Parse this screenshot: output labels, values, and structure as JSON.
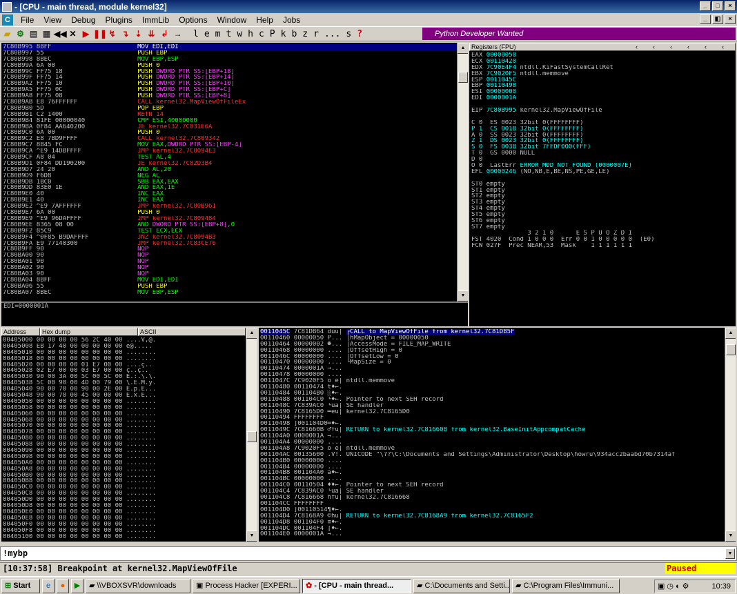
{
  "title": "- [CPU - main thread, module kernel32]",
  "menu": [
    "File",
    "View",
    "Debug",
    "Plugins",
    "ImmLib",
    "Options",
    "Window",
    "Help",
    "Jobs"
  ],
  "toolbar_letters": [
    "l",
    "e",
    "m",
    "t",
    "w",
    "h",
    "c",
    "P",
    "k",
    "b",
    "z",
    "r",
    "...",
    "s",
    "?"
  ],
  "banner": "Python Developer Wanted",
  "disasm": [
    [
      "7C80B995",
      "8BFF",
      "MOV EDI,EDI",
      "sel"
    ],
    [
      "7C80B997",
      "55",
      "PUSH EBP",
      "y"
    ],
    [
      "7C80B998",
      "8BEC",
      "MOV EBP,ESP",
      "g"
    ],
    [
      "7C80B99A",
      "6A 00",
      "PUSH 0",
      "y"
    ],
    [
      "7C80B99C",
      "FF75 18",
      "PUSH DWORD PTR SS:[EBP+18]",
      "ym"
    ],
    [
      "7C80B99F",
      "FF75 14",
      "PUSH DWORD PTR SS:[EBP+14]",
      "ym"
    ],
    [
      "7C80B9A2",
      "FF75 10",
      "PUSH DWORD PTR SS:[EBP+10]",
      "ym"
    ],
    [
      "7C80B9A5",
      "FF75 0C",
      "PUSH DWORD PTR SS:[EBP+C]",
      "ym"
    ],
    [
      "7C80B9A8",
      "FF75 08",
      "PUSH DWORD PTR SS:[EBP+8]",
      "ym"
    ],
    [
      "7C80B9AB",
      "E8 76FFFFFF",
      "CALL kernel32.MapViewOfFileEx",
      "r"
    ],
    [
      "7C80B9B0",
      "5D",
      "POP EBP",
      "y"
    ],
    [
      "7C80B9B1",
      "C2 1400",
      "RETN 14",
      "r"
    ],
    [
      "7C80B9B4",
      "81FE 00000040",
      "CMP ESI,40000000",
      "g"
    ],
    [
      "7C80B9BA",
      "0F84 AA640200",
      "JE kernel32.7C831E6A",
      "r"
    ],
    [
      "7C80B9C0",
      "6A 00",
      "PUSH 0",
      "y"
    ],
    [
      "7C80B9C2",
      "E8 7BD9FFFF",
      "CALL kernel32.7C809342",
      "r"
    ],
    [
      "7C80B9C7",
      "8B45 FC",
      "MOV EAX,DWORD PTR SS:[EBP-4]",
      "gm"
    ],
    [
      "7C80B9CA ^E9",
      "14DBFFFF",
      "JMP kernel32.7C8094E3",
      "r"
    ],
    [
      "7C80B9CF",
      "A8 04",
      "TEST AL,4",
      "g"
    ],
    [
      "7C80B9D1",
      "0F84 DD190200",
      "JE kernel32.7C82D3B4",
      "r"
    ],
    [
      "7C80B9D7",
      "24 20",
      "AND AL,20",
      "g"
    ],
    [
      "7C80B9D9",
      "F6D8",
      "NEG AL",
      "g"
    ],
    [
      "7C80B9DB",
      "1BC0",
      "SBB EAX,EAX",
      "g"
    ],
    [
      "7C80B9DD",
      "83E0 1E",
      "AND EAX,1E",
      "g"
    ],
    [
      "7C80B9E0",
      "40",
      "INC EAX",
      "g"
    ],
    [
      "7C80B9E1",
      "40",
      "INC EAX",
      "g"
    ],
    [
      "7C80B9E2 ^E9",
      "7AFFFFFF",
      "JMP kernel32.7C80B961",
      "r"
    ],
    [
      "7C80B9E7",
      "6A 00",
      "PUSH 0",
      "y"
    ],
    [
      "7C80B9E9 ^E9",
      "96DAFFFF",
      "JMP kernel32.7C809484",
      "r"
    ],
    [
      "7C80B9EE",
      "8365 08 00",
      "AND DWORD PTR SS:[EBP+8],0",
      "gm"
    ],
    [
      "7C80B9F2",
      "85C9",
      "TEST ECX,ECX",
      "g"
    ],
    [
      "7C80B9F4 ^0F85",
      "B9DAFFFF",
      "JNZ kernel32.7C8094B3",
      "r"
    ],
    [
      "7C80B9FA",
      "E9 77140300",
      "JMP kernel32.7C83CE76",
      "r"
    ],
    [
      "7C80B9FF",
      "90",
      "NOP",
      "m"
    ],
    [
      "7C80BA00",
      "90",
      "NOP",
      "m"
    ],
    [
      "7C80BA01",
      "90",
      "NOP",
      "m"
    ],
    [
      "7C80BA02",
      "90",
      "NOP",
      "m"
    ],
    [
      "7C80BA03",
      "90",
      "NOP",
      "m"
    ],
    [
      "7C80BA04",
      "8BFF",
      "MOV EDI,EDI",
      "g"
    ],
    [
      "7C80BA06",
      "55",
      "PUSH EBP",
      "y"
    ],
    [
      "7C80BA07",
      "8BEC",
      "MOV EBP,ESP",
      "g"
    ]
  ],
  "info_line": "EDI=0000001A",
  "registers_title": "Registers (FPU)",
  "registers": [
    [
      "EAX",
      "00000050",
      ""
    ],
    [
      "ECX",
      "00110420",
      ""
    ],
    [
      "EDX",
      "7C90E4F4",
      "ntdll.KiFastSystemCallRet"
    ],
    [
      "EBX",
      "7C9020F5",
      "ntdll.memmove"
    ],
    [
      "ESP",
      "0011045C",
      ""
    ],
    [
      "EBP",
      "00110498",
      ""
    ],
    [
      "ESI",
      "00000000",
      ""
    ],
    [
      "EDI",
      "0000001A",
      ""
    ]
  ],
  "eip": [
    "EIP",
    "7C80B995",
    "kernel32.MapViewOfFile"
  ],
  "flags": [
    "C 0  ES 0023 32bit 0(FFFFFFFF)",
    "P 1  CS 001B 32bit 0(FFFFFFFF)",
    "A 0  SS 0023 32bit 0(FFFFFFFF)",
    "Z 1  DS 0023 32bit 0(FFFFFFFF)",
    "S 0  FS 003B 32bit 7FFDF000(FFF)",
    "T 0  GS 0000 NULL",
    "D 0",
    "O 0  LastErr ERROR_MOD_NOT_FOUND (0000007E)"
  ],
  "efl": "EFL 00000246 (NO,NB,E,BE,NS,PE,GE,LE)",
  "st": [
    "ST0 empty",
    "ST1 empty",
    "ST2 empty",
    "ST3 empty",
    "ST4 empty",
    "ST5 empty",
    "ST6 empty",
    "ST7 empty"
  ],
  "fpu_bits": "               3 2 1 0      E S P U O Z D I",
  "fst": "FST 4020  Cond 1 0 0 0  Err 0 0 1 0 0 0 0 0  (E0)",
  "fcw": "FCW 027F  Prec NEAR,53  Mask    1 1 1 1 1 1",
  "dump_headers": [
    "Address",
    "Hex dump",
    "ASCII"
  ],
  "dump": [
    [
      "00405000",
      "00 00 00 00 56 2C 40 00",
      "....V,@."
    ],
    [
      "00405008",
      "EB 17 40 00 00 00 00 00",
      "ë\u0017@....."
    ],
    [
      "00405010",
      "00 00 00 00 00 00 00 00",
      "........"
    ],
    [
      "00405018",
      "00 00 00 00 00 00 00 00",
      "........"
    ],
    [
      "00405020",
      "00 00 00 00 01 E7 00 00",
      "....ç.."
    ],
    [
      "00405028",
      "02 E7 00 00 03 E7 00 00",
      "ç..ç.."
    ],
    [
      "00405030",
      "90 00 3A 00 5C 00 5C 00",
      "E.:.\\.\\."
    ],
    [
      "00405038",
      "5C 00 90 00 4D 00 79 00",
      "\\.E.M.y."
    ],
    [
      "00405040",
      "90 00 70 00 90 00 2E 00",
      "E.p.E..."
    ],
    [
      "00405048",
      "90 00 78 00 45 00 00 00",
      "E.x.E..."
    ],
    [
      "00405050",
      "00 00 00 00 00 00 00 00",
      "........"
    ],
    [
      "00405058",
      "00 00 00 00 00 00 00 00",
      "........"
    ],
    [
      "00405060",
      "00 00 00 00 00 00 00 00",
      "........"
    ],
    [
      "00405068",
      "00 00 00 00 00 00 00 00",
      "........"
    ],
    [
      "00405070",
      "00 00 00 00 00 00 00 00",
      "........"
    ],
    [
      "00405078",
      "00 00 00 00 00 00 00 00",
      "........"
    ],
    [
      "00405080",
      "00 00 00 00 00 00 00 00",
      "........"
    ],
    [
      "00405088",
      "00 00 00 00 00 00 00 00",
      "........"
    ],
    [
      "00405090",
      "00 00 00 00 00 00 00 00",
      "........"
    ],
    [
      "00405098",
      "00 00 00 00 00 00 00 00",
      "........"
    ],
    [
      "004050A0",
      "00 00 00 00 00 00 00 00",
      "........"
    ],
    [
      "004050A8",
      "00 00 00 00 00 00 00 00",
      "........"
    ],
    [
      "004050B0",
      "00 00 00 00 00 00 00 00",
      "........"
    ],
    [
      "004050B8",
      "00 00 00 00 00 00 00 00",
      "........"
    ],
    [
      "004050C0",
      "00 00 00 00 00 00 00 00",
      "........"
    ],
    [
      "004050C8",
      "00 00 00 00 00 00 00 00",
      "........"
    ],
    [
      "004050D0",
      "00 00 00 00 00 00 00 00",
      "........"
    ],
    [
      "004050D8",
      "00 00 00 00 00 00 00 00",
      "........"
    ],
    [
      "004050E0",
      "00 00 00 00 00 00 00 00",
      "........"
    ],
    [
      "004050E8",
      "00 00 00 00 00 00 00 00",
      "........"
    ],
    [
      "004050F0",
      "00 00 00 00 00 00 00 00",
      "........"
    ],
    [
      "004050F8",
      "00 00 00 00 00 00 00 00",
      "........"
    ],
    [
      "00405100",
      "00 00 00 00 00 00 00 00",
      "........"
    ]
  ],
  "stack": [
    [
      "0011045C",
      "7C81DB64",
      "dûü|",
      "┌CALL to MapViewOfFile from kernel32.7C81DB5F",
      "sel"
    ],
    [
      "00110460",
      "00000050",
      "P...",
      "│hMapObject = 00000050",
      ""
    ],
    [
      "00110464",
      "00000002",
      "☻...",
      "│AccessMode = FILE_MAP_WRITE",
      ""
    ],
    [
      "00110468",
      "00000000",
      "....",
      "│OffsetHigh = 0",
      ""
    ],
    [
      "0011046C",
      "00000000",
      "....",
      "│OffsetLow = 0",
      ""
    ],
    [
      "00110470",
      "00000000",
      "....",
      "└MapSize = 0",
      ""
    ],
    [
      "00110474",
      "0000001A",
      "→...",
      "",
      ""
    ],
    [
      "00110478",
      "00000000",
      "....",
      "",
      ""
    ],
    [
      "0011047C",
      "7C9020F5",
      "õ é|",
      "ntdll.memmove",
      ""
    ],
    [
      "00110480",
      "00110474",
      "t♦←.",
      "",
      ""
    ],
    [
      "00110484",
      "001104B0",
      "░♦←.",
      "",
      ""
    ],
    [
      "00110488",
      "001104C0",
      "└♦←.",
      "Pointer to next SEH record",
      ""
    ],
    [
      "0011048C",
      "7C839AC0",
      "└úä|",
      "SE handler",
      ""
    ],
    [
      "00110490",
      "7C8165D0",
      "═eü|",
      "kernel32.7C8165D0",
      ""
    ],
    [
      "00110494",
      "FFFFFFFF",
      "",
      "",
      ""
    ],
    [
      "00110498",
      "]001104D0",
      "═♦←.",
      "",
      ""
    ],
    [
      "0011049C",
      "7C81660B",
      "♂fü|",
      "RETURN to kernel32.7C81660B from kernel32.BaseInitAppcompatCache",
      "c"
    ],
    [
      "001104A0",
      "0000001A",
      "→...",
      "",
      ""
    ],
    [
      "001104A4",
      "00000000",
      "....",
      "",
      ""
    ],
    [
      "001104A8",
      "7C9020F5",
      "õ é|",
      "ntdll.memmove",
      ""
    ],
    [
      "001104AC",
      "00135600",
      ".V!.",
      "UNICODE \"\\??\\C:\\Documents and Settings\\Administrator\\Desktop\\howru\\934acc2baabd70b7314af",
      ""
    ],
    [
      "001104B0",
      "00000000",
      "....",
      "",
      ""
    ],
    [
      "001104B4",
      "00000000",
      "....",
      "",
      ""
    ],
    [
      "001104B8",
      "001104A0",
      "á♦←.",
      "",
      ""
    ],
    [
      "001104BC",
      "00000000",
      "....",
      "",
      ""
    ],
    [
      "001104C0",
      "00110504",
      "♦♦←.",
      "Pointer to next SEH record",
      ""
    ],
    [
      "001104C4",
      "7C839AC0",
      "└úä|",
      "SE handler",
      ""
    ],
    [
      "001104C8",
      "7C816668",
      "hfü|",
      "kernel32.7C816668",
      ""
    ],
    [
      "001104CC",
      "FFFFFFFF",
      "",
      "",
      ""
    ],
    [
      "001104D0",
      "]00110514",
      "¶♦←.",
      "",
      ""
    ],
    [
      "001104D4",
      "7C8168A9",
      "©hü|",
      "RETURN to kernel32.7C8168A9 from kernel32.7C8165F2",
      "c"
    ],
    [
      "001104D8",
      "001104F0",
      "≡♦←.",
      "",
      ""
    ],
    [
      "001104DC",
      "001104F4",
      "⌠♦←.",
      "",
      ""
    ],
    [
      "001104E0",
      "0000001A",
      "→...",
      "",
      ""
    ]
  ],
  "command": "!mybp",
  "status_text": "[10:37:58] Breakpoint at kernel32.MapViewOfFile",
  "status_state": "Paused",
  "taskbar": {
    "start": "Start",
    "tasks": [
      "\\\\VBOXSVR\\downloads",
      "Process Hacker [EXPERI...",
      "- [CPU - main thread...",
      "C:\\Documents and Setti...",
      "C:\\Program Files\\Immuni..."
    ],
    "clock": "10:39"
  }
}
